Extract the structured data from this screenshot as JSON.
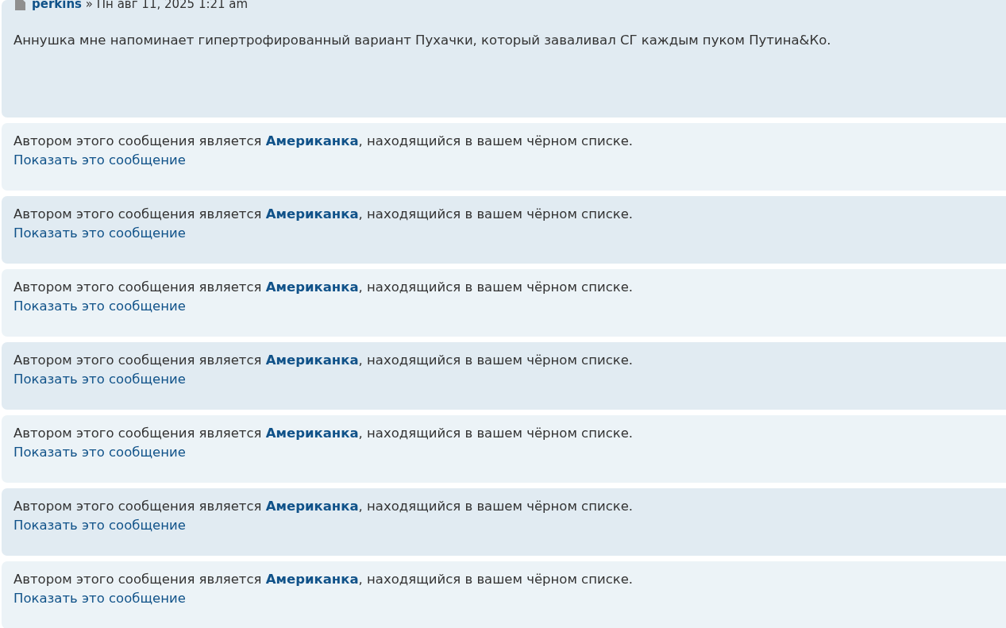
{
  "posts": [
    {
      "kind": "post",
      "author": "perkins",
      "separator": "»",
      "date": "Пн авг 11, 2025 1:21 am",
      "content": "Аннушка мне напоминает гипертрофированный вариант Пухачки, который заваливал СГ каждым пуком Путина&Ко."
    },
    {
      "kind": "ignored",
      "before": "Автором этого сообщения является",
      "author": "Американка",
      "after": ", находящийся в вашем чёрном списке.",
      "link": "Показать это сообщение"
    },
    {
      "kind": "ignored",
      "before": "Автором этого сообщения является",
      "author": "Американка",
      "after": ", находящийся в вашем чёрном списке.",
      "link": "Показать это сообщение"
    },
    {
      "kind": "ignored",
      "before": "Автором этого сообщения является",
      "author": "Американка",
      "after": ", находящийся в вашем чёрном списке.",
      "link": "Показать это сообщение"
    },
    {
      "kind": "ignored",
      "before": "Автором этого сообщения является",
      "author": "Американка",
      "after": ", находящийся в вашем чёрном списке.",
      "link": "Показать это сообщение"
    },
    {
      "kind": "ignored",
      "before": "Автором этого сообщения является",
      "author": "Американка",
      "after": ", находящийся в вашем чёрном списке.",
      "link": "Показать это сообщение"
    },
    {
      "kind": "ignored",
      "before": "Автором этого сообщения является",
      "author": "Американка",
      "after": ", находящийся в вашем чёрном списке.",
      "link": "Показать это сообщение"
    },
    {
      "kind": "ignored",
      "before": "Автором этого сообщения является",
      "author": "Американка",
      "after": ", находящийся в вашем чёрном списке.",
      "link": "Показать это сообщение"
    }
  ]
}
